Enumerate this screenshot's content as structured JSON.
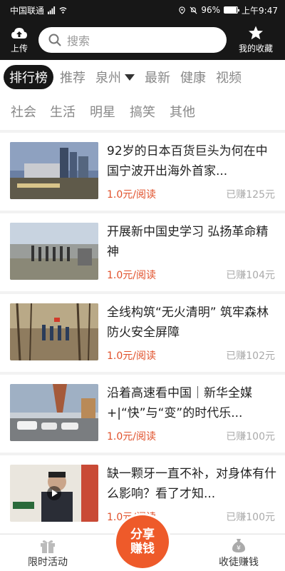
{
  "status_bar": {
    "carrier": "中国联通",
    "network": "5G",
    "battery": "96%",
    "battery_level": 0.96,
    "time": "上午9:47"
  },
  "top_bar": {
    "upload_label": "上传",
    "search_placeholder": "搜索",
    "favorites_label": "我的收藏"
  },
  "tabs_row1": [
    {
      "label": "排行榜",
      "active": true
    },
    {
      "label": "推荐"
    },
    {
      "label": "泉州",
      "dropdown": true
    },
    {
      "label": "最新"
    },
    {
      "label": "健康"
    },
    {
      "label": "视频"
    }
  ],
  "tabs_row2": [
    {
      "label": "社会"
    },
    {
      "label": "生活"
    },
    {
      "label": "明星"
    },
    {
      "label": "搞笑"
    },
    {
      "label": "其他"
    }
  ],
  "articles": [
    {
      "title": "92岁的日本百货巨头为何在中国宁波开出海外首家...",
      "price": "1.0元/阅读",
      "earned": "已赚125元",
      "thumb": "city-skyline"
    },
    {
      "title": "开展新中国史学习 弘扬革命精神",
      "price": "1.0元/阅读",
      "earned": "已赚104元",
      "thumb": "memorial-group"
    },
    {
      "title": "全线构筑“无火清明” 筑牢森林防火安全屏障",
      "price": "1.0元/阅读",
      "earned": "已赚102元",
      "thumb": "forest-patrol"
    },
    {
      "title": "沿着高速看中国｜新华全媒+|“快”与“变”的时代乐...",
      "price": "1.0元/阅读",
      "earned": "已赚100元",
      "thumb": "highway-cars"
    },
    {
      "title": "缺一颗牙一直不补，对身体有什么影响？看了才知...",
      "price": "1.0元/阅读",
      "earned": "已赚100元",
      "thumb": "doctor-video"
    }
  ],
  "bottom_bar": {
    "left_label": "限时活动",
    "center_line1": "分享",
    "center_line2": "赚钱",
    "right_label": "收徒赚钱"
  }
}
